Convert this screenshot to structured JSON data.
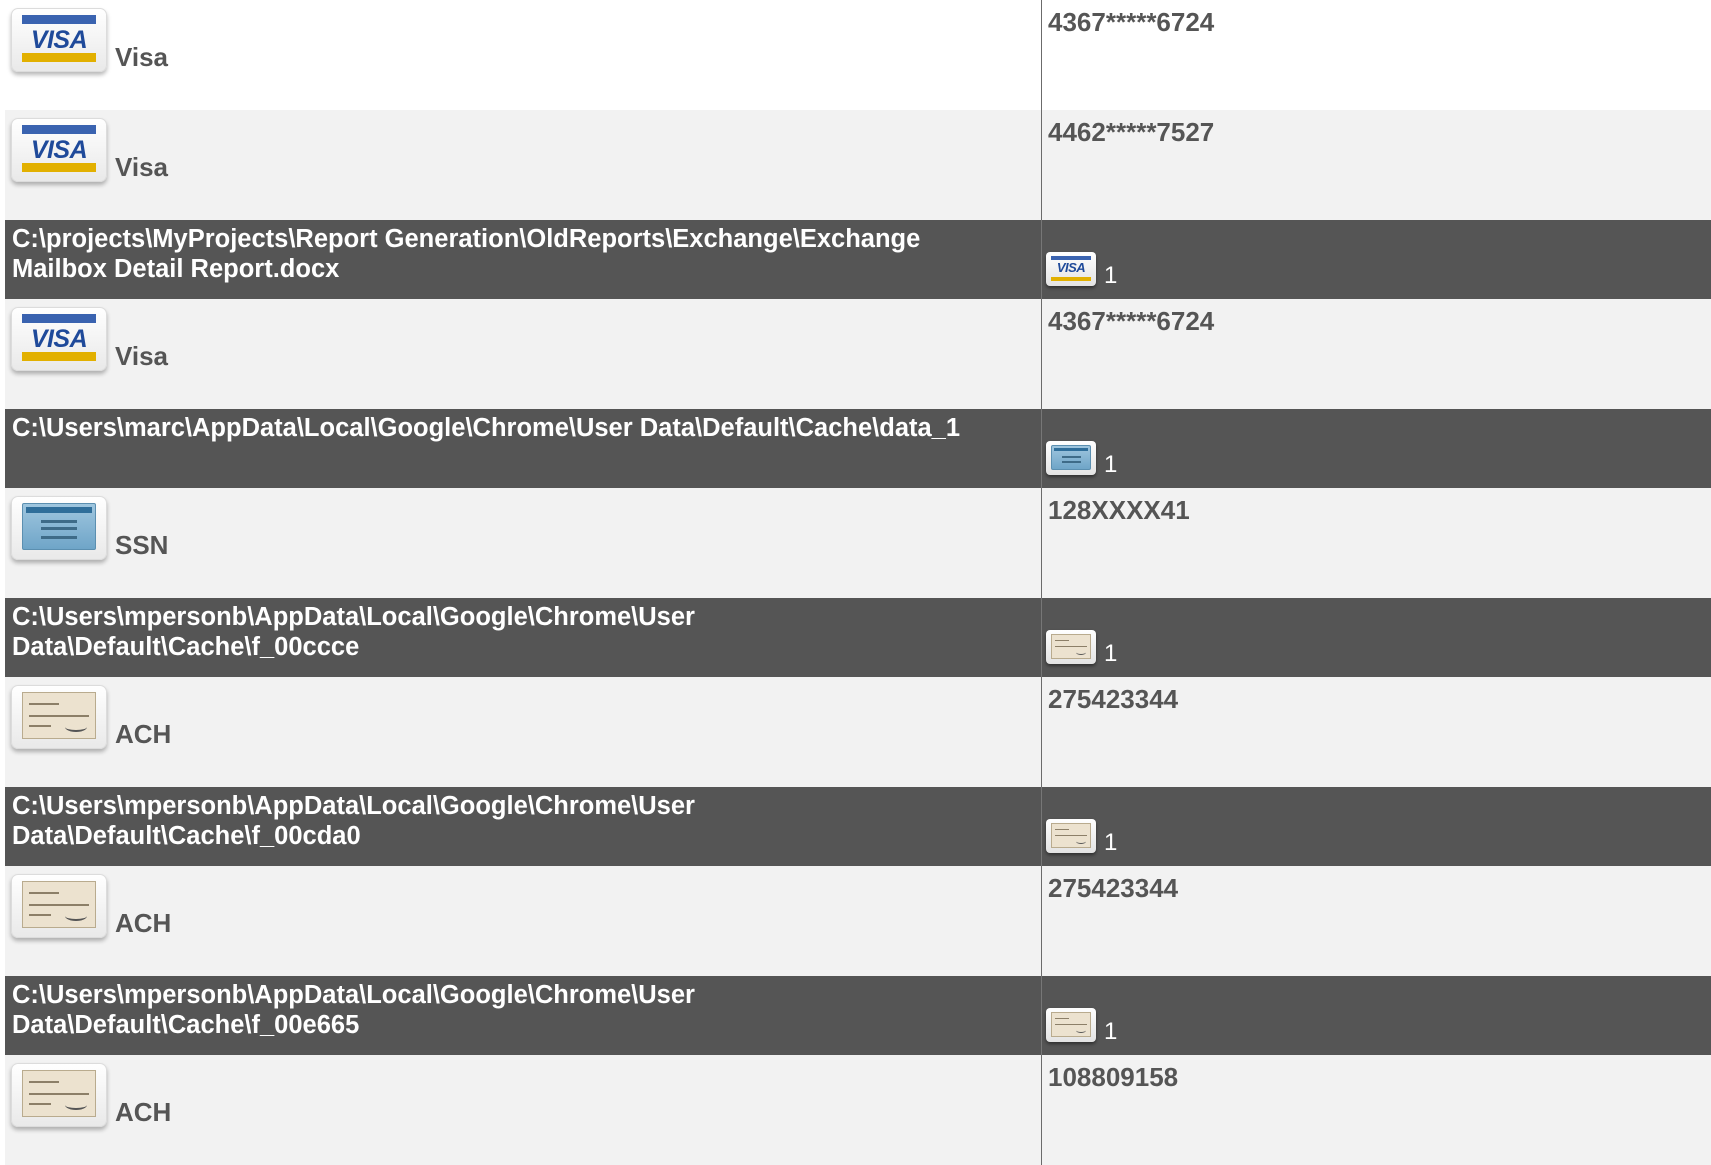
{
  "rows": [
    {
      "kind": "item",
      "icon": "visa-card-icon",
      "type": "Visa",
      "value": "4367*****6724"
    },
    {
      "kind": "item",
      "icon": "visa-card-icon",
      "type": "Visa",
      "value": "4462*****7527"
    },
    {
      "kind": "file",
      "icon": "visa-card-icon",
      "path": "C:\\projects\\MyProjects\\Report Generation\\OldReports\\Exchange\\Exchange Mailbox Detail Report.docx",
      "count": "1"
    },
    {
      "kind": "item",
      "icon": "visa-card-icon",
      "type": "Visa",
      "value": "4367*****6724"
    },
    {
      "kind": "file",
      "icon": "ssn-card-icon",
      "path": "C:\\Users\\marc\\AppData\\Local\\Google\\Chrome\\User Data\\Default\\Cache\\data_1",
      "count": "1"
    },
    {
      "kind": "item",
      "icon": "ssn-card-icon",
      "type": "SSN",
      "value": "128XXXX41"
    },
    {
      "kind": "file",
      "icon": "check-icon",
      "path": "C:\\Users\\mpersonb\\AppData\\Local\\Google\\Chrome\\User Data\\Default\\Cache\\f_00ccce",
      "count": "1"
    },
    {
      "kind": "item",
      "icon": "check-icon",
      "type": "ACH",
      "value": "275423344"
    },
    {
      "kind": "file",
      "icon": "check-icon",
      "path": "C:\\Users\\mpersonb\\AppData\\Local\\Google\\Chrome\\User Data\\Default\\Cache\\f_00cda0",
      "count": "1"
    },
    {
      "kind": "item",
      "icon": "check-icon",
      "type": "ACH",
      "value": "275423344"
    },
    {
      "kind": "file",
      "icon": "check-icon",
      "path": "C:\\Users\\mpersonb\\AppData\\Local\\Google\\Chrome\\User Data\\Default\\Cache\\f_00e665",
      "count": "1"
    },
    {
      "kind": "item",
      "icon": "check-icon",
      "type": "ACH",
      "value": "108809158"
    }
  ],
  "icon_text": {
    "visa": "VISA"
  },
  "colors": {
    "file_row_bg": "#555555",
    "item_row_alt_bg": "#f2f2f2",
    "text": "#555555"
  }
}
